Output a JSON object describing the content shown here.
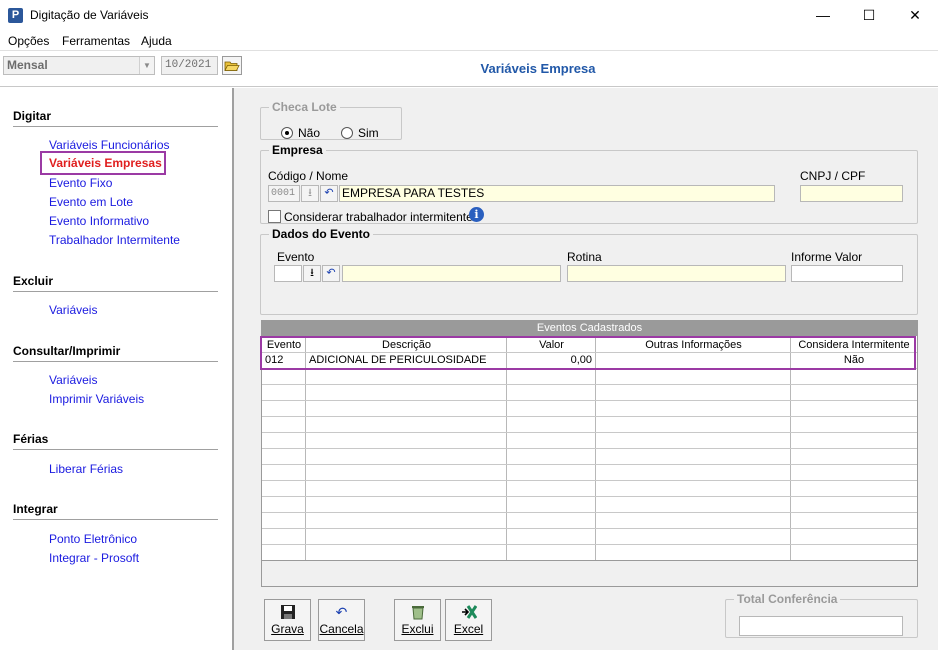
{
  "window": {
    "title": "Digitação de Variáveis",
    "app_icon": "P",
    "controls": {
      "minimize": "—",
      "maximize": "☐",
      "close": "✕"
    }
  },
  "menu": {
    "items": [
      "Opções",
      "Ferramentas",
      "Ajuda"
    ]
  },
  "toolbar": {
    "period_value": "Mensal",
    "date_value": "10/2021",
    "page_heading": "Variáveis Empresa"
  },
  "sidebar": {
    "sections": [
      {
        "title": "Digitar",
        "items": [
          "Variáveis Funcionários",
          "Variáveis Empresas",
          "Evento Fixo",
          "Evento em Lote",
          "Evento Informativo",
          "Trabalhador Intermitente"
        ]
      },
      {
        "title": "Excluir",
        "items": [
          "Variáveis"
        ]
      },
      {
        "title": "Consultar/Imprimir",
        "items": [
          "Variáveis",
          "Imprimir Variáveis"
        ]
      },
      {
        "title": "Férias",
        "items": [
          "Liberar Férias"
        ]
      },
      {
        "title": "Integrar",
        "items": [
          "Ponto Eletrônico",
          "Integrar - Prosoft"
        ]
      }
    ],
    "selected_item": "Variáveis Empresas"
  },
  "checa_lote": {
    "legend": "Checa Lote",
    "option_nao": "Não",
    "option_sim": "Sim",
    "selected": "Não"
  },
  "empresa": {
    "legend": "Empresa",
    "codigo_label": "Código / Nome",
    "codigo_value": "0001",
    "nome_value": "EMPRESA PARA TESTES",
    "cnpj_label": "CNPJ / CPF",
    "cnpj_value": "",
    "intermitente_label": "Considerar trabalhador intermitente?",
    "intermitente_checked": false
  },
  "dados_evento": {
    "legend": "Dados do Evento",
    "evento_label": "Evento",
    "rotina_label": "Rotina",
    "informe_label": "Informe Valor"
  },
  "table": {
    "caption": "Eventos Cadastrados",
    "columns": [
      "Evento",
      "Descrição",
      "Valor",
      "Outras Informações",
      "Considera Intermitente"
    ],
    "rows": [
      {
        "evento": "012",
        "descricao": "ADICIONAL DE PERICULOSIDADE",
        "valor": "0,00",
        "outras": "",
        "intermitente": "Não"
      }
    ]
  },
  "buttons": {
    "grava": "Grava",
    "cancela": "Cancela",
    "exclui": "Exclui",
    "excel": "Excel"
  },
  "total_conferencia": {
    "legend": "Total Conferência",
    "value": ""
  },
  "colors": {
    "accent_blue": "#2158a8",
    "link_blue": "#1a1ae0",
    "selected_red": "#e01f1f",
    "highlight_purple": "#9b3aa4",
    "field_yellow": "#ffffe1"
  }
}
